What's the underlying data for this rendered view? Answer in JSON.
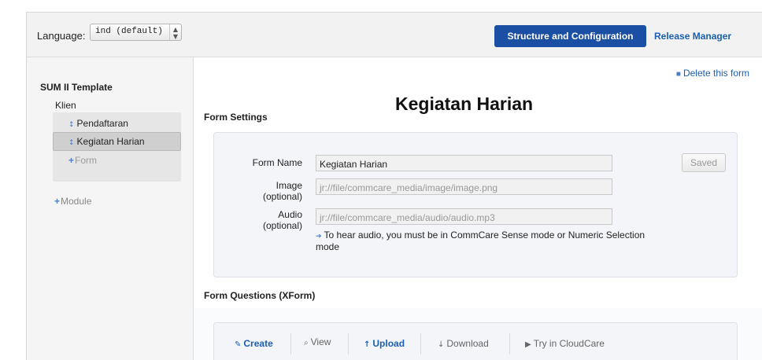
{
  "topbar": {
    "language_label": "Language:",
    "language_value": "ind (default)",
    "structure_button": "Structure and Configuration",
    "release_link": "Release Manager"
  },
  "sidebar": {
    "app_name": "SUM II Template",
    "module_name": "Klien",
    "forms": [
      {
        "label": "Pendaftaran",
        "selected": false
      },
      {
        "label": "Kegiatan Harian",
        "selected": true
      }
    ],
    "add_form_label": "Form",
    "add_module_label": "Module"
  },
  "main": {
    "delete_label": "Delete this form",
    "form_title": "Kegiatan Harian",
    "settings_heading": "Form Settings",
    "fields": {
      "name_label": "Form Name",
      "name_value": "Kegiatan Harian",
      "image_label": "Image",
      "image_optional": "(optional)",
      "image_placeholder": "jr://file/commcare_media/image/image.png",
      "audio_label": "Audio",
      "audio_optional": "(optional)",
      "audio_placeholder": "jr://file/commcare_media/audio/audio.mp3",
      "audio_note": "To hear audio, you must be in CommCare Sense mode or Numeric Selection mode"
    },
    "saved_button": "Saved",
    "questions_heading": "Form Questions (XForm)",
    "tools": {
      "create": "Create",
      "view": "View",
      "upload": "Upload",
      "download": "Download",
      "try": "Try in CloudCare"
    }
  },
  "colors": {
    "primary_button": "#1b4fa3",
    "link": "#1b5fb3",
    "icon_blue": "#4d7fc4"
  }
}
